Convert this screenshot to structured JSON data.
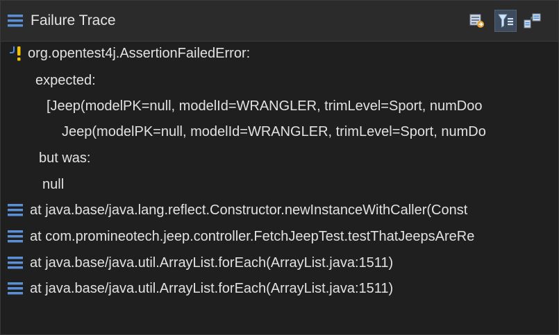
{
  "view": {
    "title": "Failure Trace"
  },
  "toolbar": {
    "buttons": [
      {
        "name": "compare-results-icon",
        "active": false
      },
      {
        "name": "filter-stack-trace-icon",
        "active": true
      },
      {
        "name": "copy-trace-icon",
        "active": false
      }
    ]
  },
  "trace": {
    "error_line": "org.opentest4j.AssertionFailedError:",
    "message_lines": [
      "expected:",
      "[Jeep(modelPK=null, modelId=WRANGLER, trimLevel=Sport, numDoo",
      "Jeep(modelPK=null, modelId=WRANGLER, trimLevel=Sport, numDo",
      "but was:",
      "null"
    ],
    "frames": [
      "at java.base/java.lang.reflect.Constructor.newInstanceWithCaller(Const",
      "at com.promineotech.jeep.controller.FetchJeepTest.testThatJeepsAreRe",
      "at java.base/java.util.ArrayList.forEach(ArrayList.java:1511)",
      "at java.base/java.util.ArrayList.forEach(ArrayList.java:1511)"
    ]
  },
  "colors": {
    "frame_icon": "#5b8fd6",
    "warning": "#f2c200",
    "fail_marker": "#4a8fe0",
    "text": "#e2e2e2"
  }
}
